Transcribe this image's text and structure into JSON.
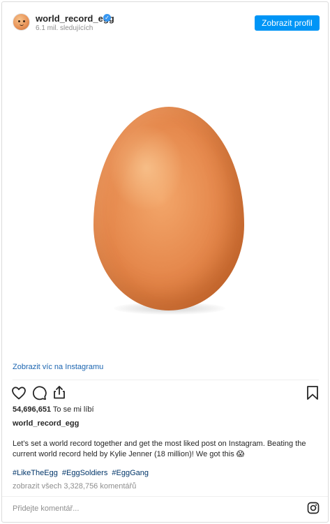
{
  "header": {
    "username": "world_record_egg",
    "verified_mark": "✓",
    "followers": "6.1 mil. sledujících",
    "profile_button": "Zobrazit profil"
  },
  "post": {
    "view_more_link": "Zobrazit víc na Instagramu",
    "likes_count": "54,696,651",
    "likes_label": "To se mi líbí",
    "author": "world_record_egg",
    "caption": "Let’s set a world record together and get the most liked post on Instagram. Beating the current world record held by Kylie Jenner (18 million)! We got this 😱",
    "hashtags": [
      "#LikeTheEgg",
      "#EggSoldiers",
      "#EggGang"
    ],
    "view_comments": "zobrazit všech 3,328,756 komentářů"
  },
  "comment": {
    "placeholder": "Přidejte komentář..."
  },
  "icons": {
    "like": "heart-icon",
    "comment": "comment-icon",
    "share": "share-icon",
    "save": "bookmark-icon",
    "brand": "instagram-icon"
  },
  "colors": {
    "accent": "#0095f6",
    "link": "#003569",
    "muted": "#8e8e8e",
    "text": "#262626"
  }
}
